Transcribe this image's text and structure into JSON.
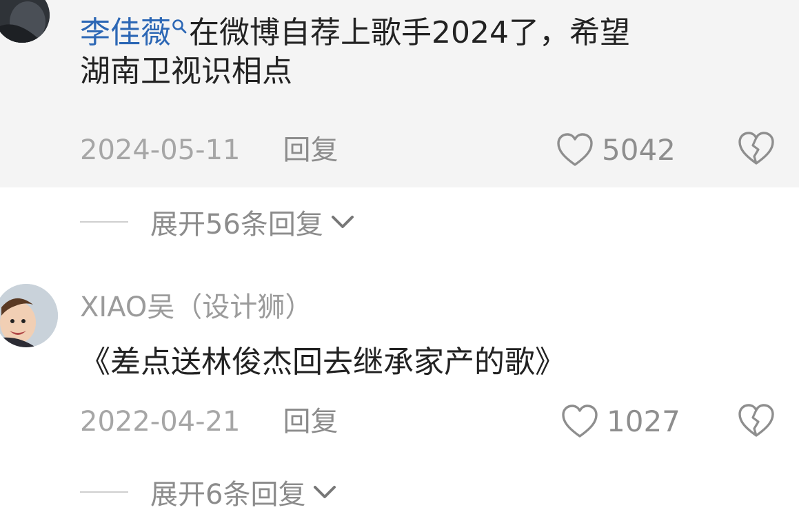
{
  "comments": [
    {
      "mention": "李佳薇",
      "text_after_mention": "在微博自荐上歌手2024了，希望",
      "text_line2": "湖南卫视识相点",
      "date": "2024-05-11",
      "reply_label": "回复",
      "likes": "5042",
      "expand_label": "展开56条回复"
    },
    {
      "username": "XIAO吴（设计狮）",
      "text": "《差点送林俊杰回去继承家产的歌》",
      "date": "2022-04-21",
      "reply_label": "回复",
      "likes": "1027",
      "expand_label": "展开6条回复"
    }
  ],
  "colors": {
    "mention": "#2c67b5",
    "meta": "#a6a6a6",
    "body_text": "#222222"
  },
  "icons": [
    "search-icon",
    "like-heart-icon",
    "dislike-broken-heart-icon",
    "chevron-down-icon"
  ]
}
